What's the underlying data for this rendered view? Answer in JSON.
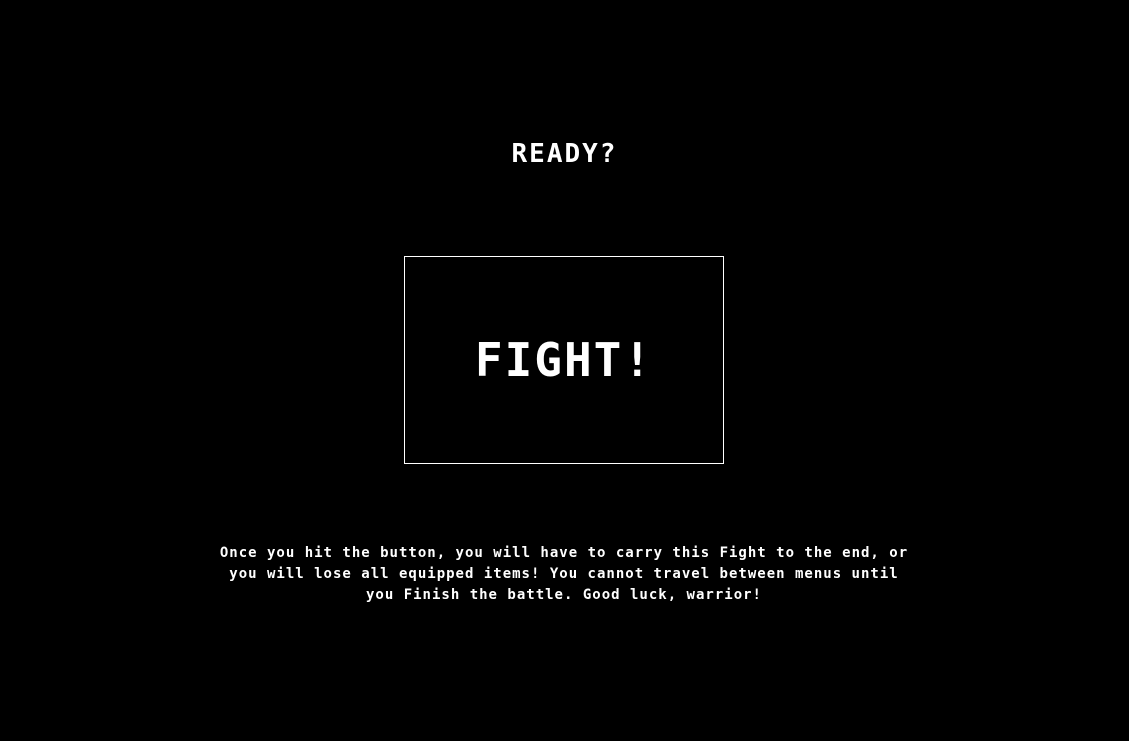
{
  "screen": {
    "title": "READY?",
    "button_label": "FIGHT!",
    "warning": "Once you hit the button, you will have to carry this Fight to the end, or you will lose all equipped items! You cannot travel between menus until you Finish the battle. Good luck, warrior!"
  },
  "colors": {
    "background": "#000000",
    "foreground": "#ffffff"
  }
}
